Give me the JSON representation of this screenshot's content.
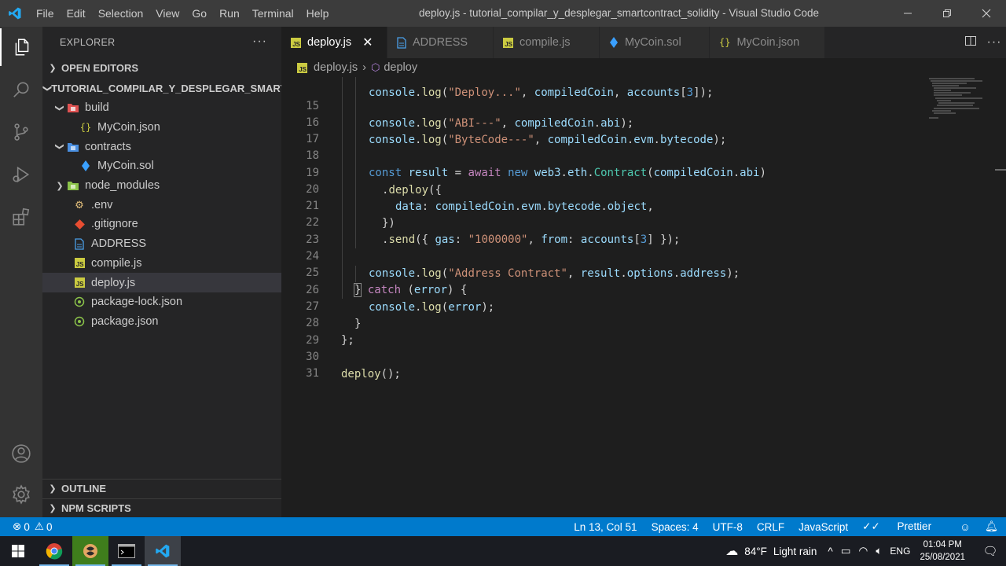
{
  "window": {
    "title": "deploy.js - tutorial_compilar_y_desplegar_smartcontract_solidity - Visual Studio Code",
    "menu": [
      "File",
      "Edit",
      "Selection",
      "View",
      "Go",
      "Run",
      "Terminal",
      "Help"
    ]
  },
  "sidebar": {
    "header": "EXPLORER",
    "open_editors": "OPEN EDITORS",
    "project": "TUTORIAL_COMPILAR_Y_DESPLEGAR_SMARTC...",
    "tree": [
      {
        "label": "build",
        "icon": "folder-red-icon"
      },
      {
        "label": "MyCoin.json",
        "icon": "json-file-icon"
      },
      {
        "label": "contracts",
        "icon": "folder-blue-icon"
      },
      {
        "label": "MyCoin.sol",
        "icon": "solidity-file-icon"
      },
      {
        "label": "node_modules",
        "icon": "folder-green-icon"
      },
      {
        "label": ".env",
        "icon": "env-file-icon"
      },
      {
        "label": ".gitignore",
        "icon": "git-file-icon"
      },
      {
        "label": "ADDRESS",
        "icon": "text-file-icon"
      },
      {
        "label": "compile.js",
        "icon": "js-file-icon"
      },
      {
        "label": "deploy.js",
        "icon": "js-file-icon"
      },
      {
        "label": "package-lock.json",
        "icon": "npm-file-icon"
      },
      {
        "label": "package.json",
        "icon": "npm-file-icon"
      }
    ],
    "outline": "OUTLINE",
    "npm_scripts": "NPM SCRIPTS"
  },
  "tabs": [
    {
      "label": "deploy.js",
      "icon": "js-file-icon",
      "active": true
    },
    {
      "label": "ADDRESS",
      "icon": "text-file-icon"
    },
    {
      "label": "compile.js",
      "icon": "js-file-icon"
    },
    {
      "label": "MyCoin.sol",
      "icon": "solidity-file-icon"
    },
    {
      "label": "MyCoin.json",
      "icon": "json-file-icon"
    }
  ],
  "breadcrumb": {
    "file": "deploy.js",
    "symbol": "deploy"
  },
  "editor": {
    "line_numbers": [
      "15",
      "16",
      "17",
      "18",
      "19",
      "20",
      "21",
      "22",
      "23",
      "24",
      "25",
      "26",
      "27",
      "28",
      "29",
      "30",
      "31"
    ]
  },
  "statusbar": {
    "errors": "0",
    "warnings": "0",
    "position": "Ln 13, Col 51",
    "spaces": "Spaces: 4",
    "encoding": "UTF-8",
    "eol": "CRLF",
    "language": "JavaScript",
    "prettier": "Prettier"
  },
  "taskbar": {
    "weather_temp": "84°F",
    "weather_desc": "Light rain",
    "language": "ENG",
    "time": "01:04 PM",
    "date": "25/08/2021"
  },
  "colors": {
    "accent": "#007acc",
    "titlebar": "#3c3c3c",
    "sidebar": "#252526",
    "editor": "#1e1e1e"
  }
}
